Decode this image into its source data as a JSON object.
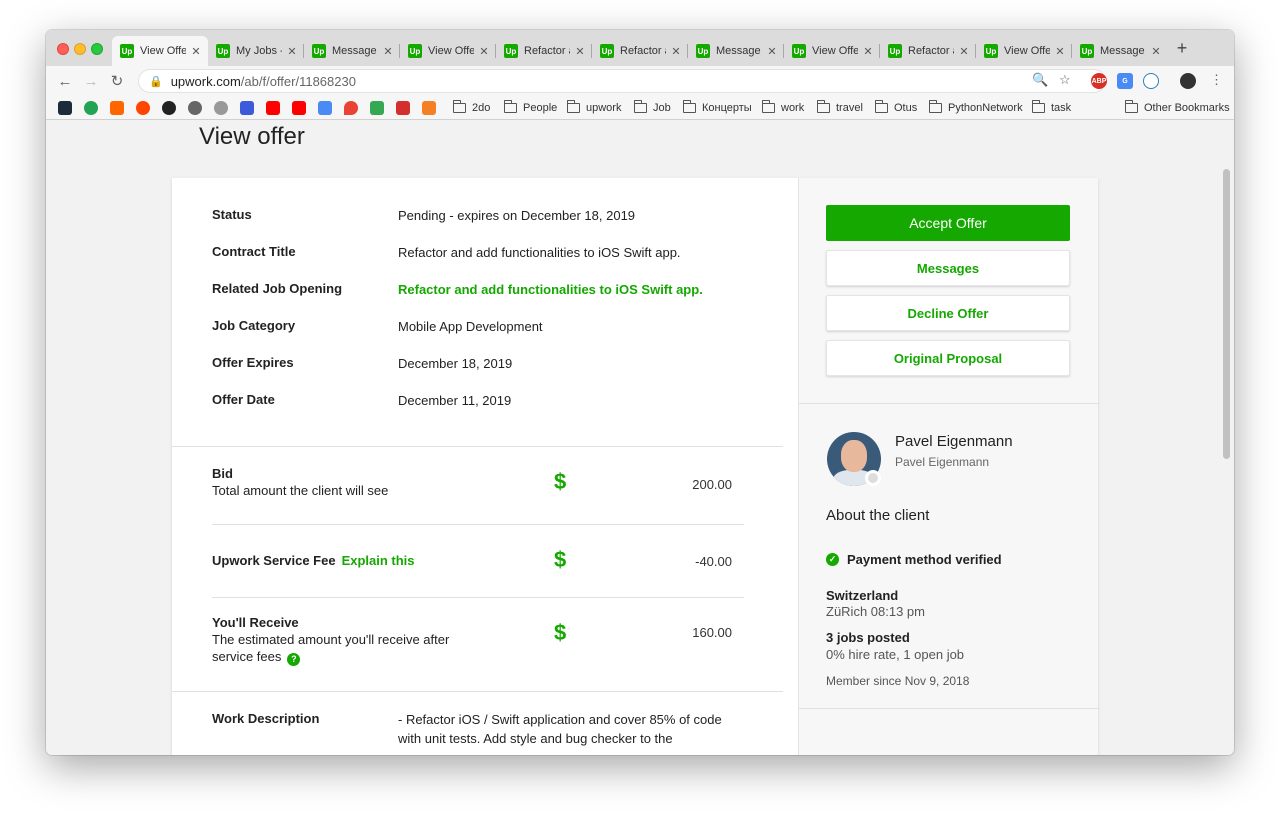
{
  "tabs": [
    {
      "label": "View Offe",
      "active": true
    },
    {
      "label": "My Jobs -",
      "active": false
    },
    {
      "label": "Message",
      "active": false
    },
    {
      "label": "View Offe",
      "active": false
    },
    {
      "label": "Refactor a",
      "active": false
    },
    {
      "label": "Refactor a",
      "active": false
    },
    {
      "label": "Message",
      "active": false
    },
    {
      "label": "View Offe",
      "active": false
    },
    {
      "label": "Refactor a",
      "active": false
    },
    {
      "label": "View Offe",
      "active": false
    },
    {
      "label": "Message",
      "active": false
    }
  ],
  "favicon_text": "Up",
  "close_glyph": "✕",
  "new_tab_glyph": "+",
  "address": {
    "domain": "upwork.com",
    "path": "/ab/f/offer/11868230"
  },
  "bookmarks": {
    "folders": [
      "2do",
      "People",
      "upwork",
      "Job",
      "Концерты",
      "work",
      "travel",
      "Otus",
      "PythonNetwork",
      "task"
    ],
    "other": "Other Bookmarks"
  },
  "page": {
    "title": "View offer",
    "details": [
      {
        "label": "Status",
        "value": "Pending - expires on December 18, 2019"
      },
      {
        "label": "Contract Title",
        "value": "Refactor and add functionalities to iOS Swift app."
      },
      {
        "label": "Related Job Opening",
        "value": "Refactor and add functionalities to iOS Swift app."
      },
      {
        "label": "Job Category",
        "value": "Mobile App Development"
      },
      {
        "label": "Offer Expires",
        "value": "December 18, 2019"
      },
      {
        "label": "Offer Date",
        "value": "December 11, 2019"
      }
    ],
    "currency_symbol": "$",
    "bid": {
      "title": "Bid",
      "subtitle": "Total amount the client will see",
      "amount": "200.00"
    },
    "fee": {
      "title": "Upwork Service Fee",
      "explain_link": "Explain this",
      "amount": "-40.00"
    },
    "receive": {
      "title": "You'll Receive",
      "subtitle": "The estimated amount you'll receive after service fees",
      "amount": "160.00",
      "help": "?"
    },
    "work": {
      "label": "Work Description",
      "text": "- Refactor iOS / Swift application and cover 85% of code with unit tests. Add style and bug checker to the"
    }
  },
  "actions": {
    "accept": "Accept Offer",
    "messages": "Messages",
    "decline": "Decline Offer",
    "proposal": "Original Proposal"
  },
  "client": {
    "name": "Pavel Eigenmann",
    "subname": "Pavel Eigenmann",
    "about": "About the client",
    "verified": "Payment method verified",
    "country": "Switzerland",
    "city_time": "ZüRich 08:13 pm",
    "jobs_posted": "3 jobs posted",
    "hire_rate": "0% hire rate, 1 open job",
    "member_since": "Member since Nov 9, 2018"
  },
  "colors": {
    "brand": "#14a800"
  }
}
